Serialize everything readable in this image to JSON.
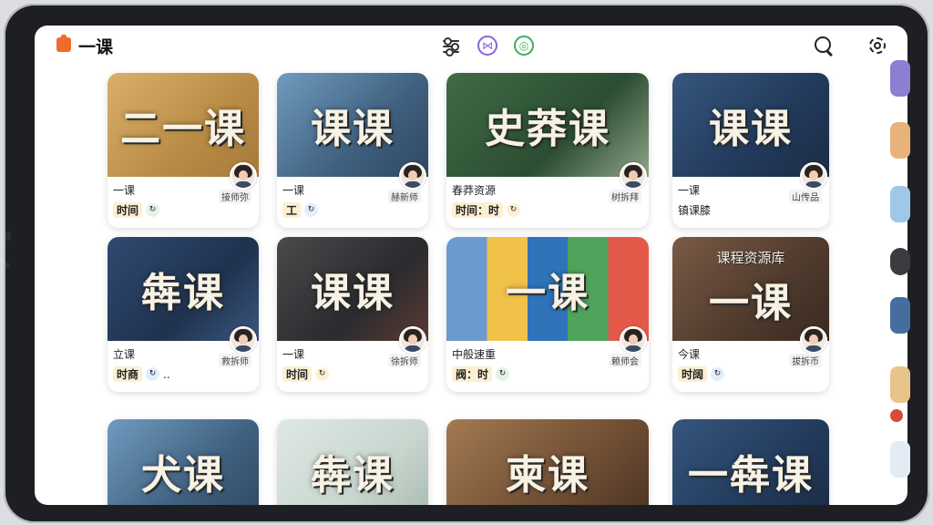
{
  "app": {
    "title": "一课"
  },
  "toolbar": {
    "icons": [
      "filter-icon",
      "purple-circle-icon",
      "green-circle-icon",
      "search-icon",
      "gear-icon"
    ]
  },
  "colors": {
    "accent": "#f06b2b",
    "purple": "#8e62d6",
    "green": "#3cae5b",
    "tag_bg": "#fcefd2"
  },
  "cards": [
    {
      "thumb_title": "二一课",
      "thumb_sub": "",
      "line1": "一课",
      "line2": "时间",
      "line2_extra": "",
      "teacher": "接师弥",
      "bg": "gold"
    },
    {
      "thumb_title": "课课",
      "thumb_sub": "",
      "line1": "一课",
      "line2": "工",
      "line2_extra": "",
      "teacher": "赫新师",
      "bg": "blue"
    },
    {
      "thumb_title": "史莽课",
      "thumb_sub": "",
      "line1": "春莽资源",
      "line2": "时间：时",
      "line2_extra": "",
      "teacher": "树拆拜",
      "bg": "green"
    },
    {
      "thumb_title": "课课",
      "thumb_sub": "",
      "line1": "一课",
      "line2": "",
      "line2_extra": "镇课膝",
      "teacher": "山传品",
      "bg": "navy"
    },
    {
      "thumb_title": "犇课",
      "thumb_sub": "",
      "line1": "立课",
      "line2": "时商",
      "line2_extra": "..",
      "teacher": "救拆师",
      "bg": "navy2"
    },
    {
      "thumb_title": "课课",
      "thumb_sub": "",
      "line1": "一课",
      "line2": "时间",
      "line2_extra": "",
      "teacher": "徐拆师",
      "bg": "dark"
    },
    {
      "thumb_title": "一课",
      "thumb_sub": "",
      "line1": "中般速重",
      "line2": "阀：时",
      "line2_extra": "",
      "teacher": "赖师会",
      "bg": "colorful"
    },
    {
      "thumb_title": "一课",
      "thumb_sub": "课程资源库",
      "line1": "今课",
      "line2": "时阔",
      "line2_extra": "",
      "teacher": "拔拆币",
      "bg": "brown"
    },
    {
      "thumb_title": "犬课",
      "thumb_sub": "",
      "line1": "",
      "line2": "",
      "line2_extra": "",
      "teacher": "",
      "bg": "blue"
    },
    {
      "thumb_title": "犇课",
      "thumb_sub": "",
      "line1": "",
      "line2": "",
      "line2_extra": "",
      "teacher": "",
      "bg": "light"
    },
    {
      "thumb_title": "柬课",
      "thumb_sub": "",
      "line1": "",
      "line2": "",
      "line2_extra": "",
      "teacher": "",
      "bg": "brown2"
    },
    {
      "thumb_title": "一犇课",
      "thumb_sub": "",
      "line1": "",
      "line2": "",
      "line2_extra": "",
      "teacher": "",
      "bg": "navy"
    }
  ]
}
